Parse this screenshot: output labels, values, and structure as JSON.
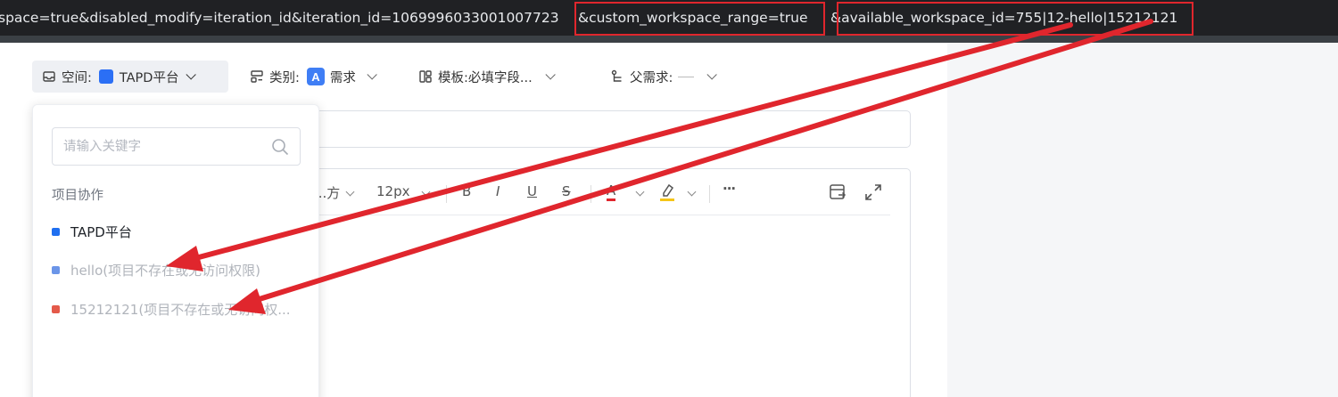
{
  "url_bar": {
    "text_part1": "space=true&disabled_modify=iteration_id&iteration_id=1069996033001007723",
    "text_part2": "&custom_workspace_range=true",
    "text_part3": "&available_workspace_id=755|12-hello|15212121"
  },
  "fields": {
    "workspace": {
      "label": "空间:",
      "value": "TAPD平台",
      "color": "#2b6ff5"
    },
    "type": {
      "label": "类别:",
      "badge": "A",
      "value": "需求",
      "color": "#3f7ef5"
    },
    "template": {
      "label": "模板:",
      "value": "必填字段..."
    },
    "parent": {
      "label": "父需求:"
    }
  },
  "editor": {
    "font_family_label": "...方",
    "font_size_label": "12px",
    "bold_label": "B",
    "italic_label": "I",
    "underline_label": "U",
    "strike_label": "S",
    "font_color_label": "A",
    "more_label": "···",
    "font_color": "#e0262d",
    "highlight_color": "#f5c518"
  },
  "dropdown": {
    "search_placeholder": "请输入关键字",
    "group_label": "项目协作",
    "items": [
      {
        "label": "TAPD平台",
        "color": "#1f6ff0",
        "disabled": false
      },
      {
        "label": "hello(项目不存在或无访问权限)",
        "color": "#6b95e8",
        "disabled": true
      },
      {
        "label": "15212121(项目不存在或无访问权...",
        "color": "#e45a4a",
        "disabled": true
      }
    ]
  },
  "annotation_color": "#e0262d"
}
